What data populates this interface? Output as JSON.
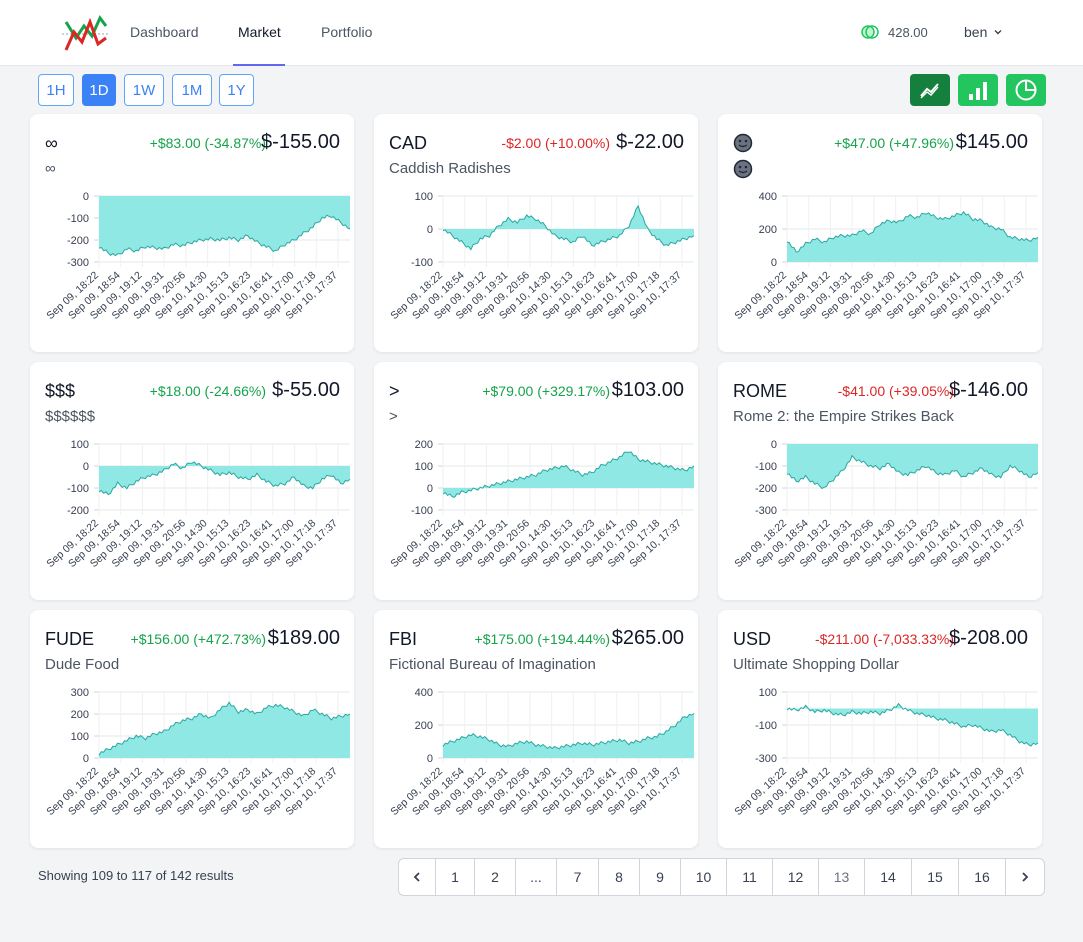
{
  "nav": {
    "links": [
      {
        "label": "Dashboard",
        "active": false
      },
      {
        "label": "Market",
        "active": true
      },
      {
        "label": "Portfolio",
        "active": false
      }
    ],
    "balance": "428.00",
    "user": "ben"
  },
  "ranges": [
    {
      "label": "1H",
      "active": false
    },
    {
      "label": "1D",
      "active": true
    },
    {
      "label": "1W",
      "active": false
    },
    {
      "label": "1M",
      "active": false
    },
    {
      "label": "1Y",
      "active": false
    }
  ],
  "views": [
    {
      "icon": "line-chart-icon",
      "color": "#15803d"
    },
    {
      "icon": "bar-chart-icon",
      "color": "#22c55e"
    },
    {
      "icon": "pie-chart-icon",
      "color": "#22c55e"
    }
  ],
  "x_ticks": [
    "Sep 09, 18:22",
    "Sep 09, 18:54",
    "Sep 09, 19:12",
    "Sep 09, 19:31",
    "Sep 09, 20:56",
    "Sep 10, 14:30",
    "Sep 10, 15:13",
    "Sep 10, 16:23",
    "Sep 10, 16:41",
    "Sep 10, 17:00",
    "Sep 10, 17:18",
    "Sep 10, 17:37"
  ],
  "chart_data": [
    {
      "type": "area",
      "symbol": "∞",
      "name": "∞",
      "change": "+$83.00 (-34.87%)",
      "positive": true,
      "price": "$-155.00",
      "ylim": [
        -300,
        0
      ],
      "yticks": [
        0,
        -100,
        -200,
        -300
      ],
      "y": [
        -230,
        -260,
        -270,
        -240,
        -250,
        -230,
        -235,
        -240,
        -220,
        -225,
        -210,
        -200,
        -195,
        -200,
        -190,
        -200,
        -180,
        -210,
        -230,
        -250,
        -220,
        -200,
        -170,
        -140,
        -100,
        -90,
        -120,
        -150
      ]
    },
    {
      "type": "area",
      "symbol": "CAD",
      "name": "Caddish Radishes",
      "change": "-$2.00 (+10.00%)",
      "positive": false,
      "price": "$-22.00",
      "ylim": [
        -100,
        100
      ],
      "yticks": [
        100,
        0,
        -100
      ],
      "y": [
        0,
        -20,
        -40,
        -60,
        -30,
        -20,
        10,
        30,
        20,
        40,
        30,
        10,
        -20,
        -30,
        -40,
        -20,
        -50,
        -40,
        -30,
        -20,
        10,
        70,
        0,
        -30,
        -50,
        -40,
        -30,
        -20
      ]
    },
    {
      "type": "area",
      "symbol": "☻",
      "name": "☻",
      "change": "+$47.00 (+47.96%)",
      "positive": true,
      "price": "$145.00",
      "ylim": [
        0,
        400
      ],
      "yticks": [
        400,
        200,
        0
      ],
      "smiley": true,
      "y": [
        130,
        60,
        110,
        140,
        120,
        150,
        160,
        160,
        190,
        170,
        230,
        250,
        240,
        280,
        270,
        300,
        270,
        260,
        280,
        300,
        260,
        250,
        210,
        200,
        150,
        140,
        130,
        150
      ]
    },
    {
      "type": "area",
      "symbol": "$$$",
      "name": "$$$$$$",
      "change": "+$18.00 (-24.66%)",
      "positive": true,
      "price": "$-55.00",
      "ylim": [
        -200,
        100
      ],
      "yticks": [
        100,
        0,
        -100,
        -200
      ],
      "y": [
        -110,
        -130,
        -80,
        -100,
        -70,
        -50,
        -40,
        -20,
        10,
        -10,
        20,
        0,
        -20,
        -40,
        -30,
        -50,
        -60,
        -40,
        -70,
        -90,
        -80,
        -50,
        -90,
        -100,
        -60,
        -40,
        -80,
        -60
      ]
    },
    {
      "type": "area",
      "symbol": ">",
      "name": ">",
      "change": "+$79.00 (+329.17%)",
      "positive": true,
      "price": "$103.00",
      "ylim": [
        -100,
        200
      ],
      "yticks": [
        200,
        100,
        0,
        -100
      ],
      "y": [
        -20,
        -40,
        -20,
        -10,
        0,
        10,
        20,
        30,
        40,
        50,
        60,
        80,
        90,
        100,
        80,
        60,
        70,
        100,
        120,
        140,
        170,
        130,
        120,
        110,
        100,
        90,
        80,
        100
      ]
    },
    {
      "type": "area",
      "symbol": "ROME",
      "name": "Rome 2: the Empire Strikes Back",
      "change": "-$41.00 (+39.05%)",
      "positive": false,
      "price": "$-146.00",
      "ylim": [
        -300,
        0
      ],
      "yticks": [
        0,
        -100,
        -200,
        -300
      ],
      "y": [
        -130,
        -170,
        -150,
        -180,
        -200,
        -160,
        -120,
        -60,
        -80,
        -100,
        -110,
        -90,
        -130,
        -140,
        -120,
        -100,
        -130,
        -140,
        -120,
        -150,
        -130,
        -110,
        -140,
        -150,
        -100,
        -120,
        -150,
        -130
      ]
    },
    {
      "type": "area",
      "symbol": "FUDE",
      "name": "Dude Food",
      "change": "+$156.00 (+472.73%)",
      "positive": true,
      "price": "$189.00",
      "ylim": [
        0,
        300
      ],
      "yticks": [
        300,
        200,
        100,
        0
      ],
      "y": [
        20,
        40,
        60,
        80,
        100,
        90,
        110,
        120,
        150,
        170,
        180,
        200,
        180,
        220,
        250,
        210,
        220,
        200,
        230,
        240,
        230,
        210,
        190,
        220,
        200,
        180,
        190,
        200
      ]
    },
    {
      "type": "area",
      "symbol": "FBI",
      "name": "Fictional Bureau of Imagination",
      "change": "+$175.00 (+194.44%)",
      "positive": true,
      "price": "$265.00",
      "ylim": [
        0,
        400
      ],
      "yticks": [
        400,
        200,
        0
      ],
      "y": [
        80,
        100,
        120,
        140,
        130,
        110,
        80,
        70,
        90,
        100,
        80,
        70,
        60,
        70,
        80,
        90,
        80,
        90,
        100,
        110,
        90,
        100,
        120,
        130,
        160,
        200,
        250,
        270
      ]
    },
    {
      "type": "area",
      "symbol": "USD",
      "name": "Ultimate Shopping Dollar",
      "change": "-$211.00 (-7,033.33%)",
      "positive": false,
      "price": "$-208.00",
      "ylim": [
        -300,
        100
      ],
      "yticks": [
        100,
        -100,
        -300
      ],
      "y": [
        0,
        -10,
        10,
        -20,
        -10,
        -30,
        -40,
        -20,
        -30,
        -20,
        -30,
        -10,
        20,
        -10,
        -30,
        -40,
        -60,
        -70,
        -90,
        -110,
        -100,
        -120,
        -140,
        -130,
        -160,
        -200,
        -220,
        -210
      ]
    }
  ],
  "footer": {
    "results_text": "Showing 109 to 117 of 142 results",
    "pages": [
      "1",
      "2",
      "...",
      "7",
      "8",
      "9",
      "10",
      "11",
      "12",
      "13",
      "14",
      "15",
      "16"
    ],
    "current_page": "13"
  },
  "colors": {
    "area_fill": "#8fe8e3",
    "area_stroke": "#2aa7a1",
    "accent": "#3b82f6",
    "positive": "#16a34a",
    "negative": "#dc2626"
  }
}
